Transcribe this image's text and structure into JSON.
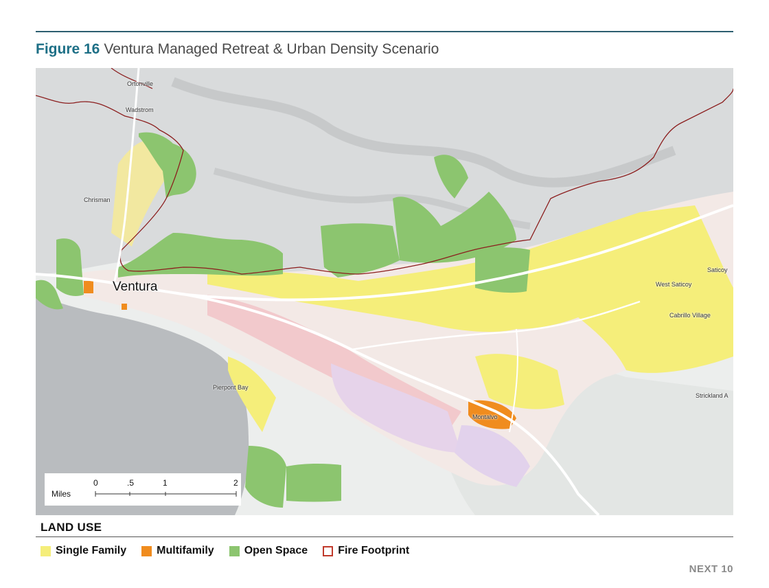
{
  "figure": {
    "number": "Figure 16",
    "title": "Ventura Managed Retreat & Urban Density Scenario"
  },
  "map": {
    "places": {
      "ortonville": "Ortonville",
      "wadstrom": "Wadstrom",
      "chrisman": "Chrisman",
      "ventura": "Ventura",
      "pierpont_bay": "Pierpont Bay",
      "montalvo": "Montalvo",
      "west_saticoy": "West Saticoy",
      "saticoy": "Saticoy",
      "cabrillo_village": "Cabrillo Village",
      "strickland": "Strickland A"
    },
    "scale": {
      "unit": "Miles",
      "ticks": [
        "0",
        ".5",
        "1",
        "2"
      ]
    }
  },
  "legend": {
    "title": "LAND USE",
    "items": [
      {
        "label": "Single Family",
        "color": "#f5ee7a",
        "icon": "filled-square"
      },
      {
        "label": "Multifamily",
        "color": "#f08c1e",
        "icon": "filled-square"
      },
      {
        "label": "Open Space",
        "color": "#8cc56f",
        "icon": "filled-square"
      },
      {
        "label": "Fire Footprint",
        "color": "#c0392b",
        "icon": "outline-square"
      }
    ]
  },
  "footer": {
    "text": "NEXT 10"
  }
}
